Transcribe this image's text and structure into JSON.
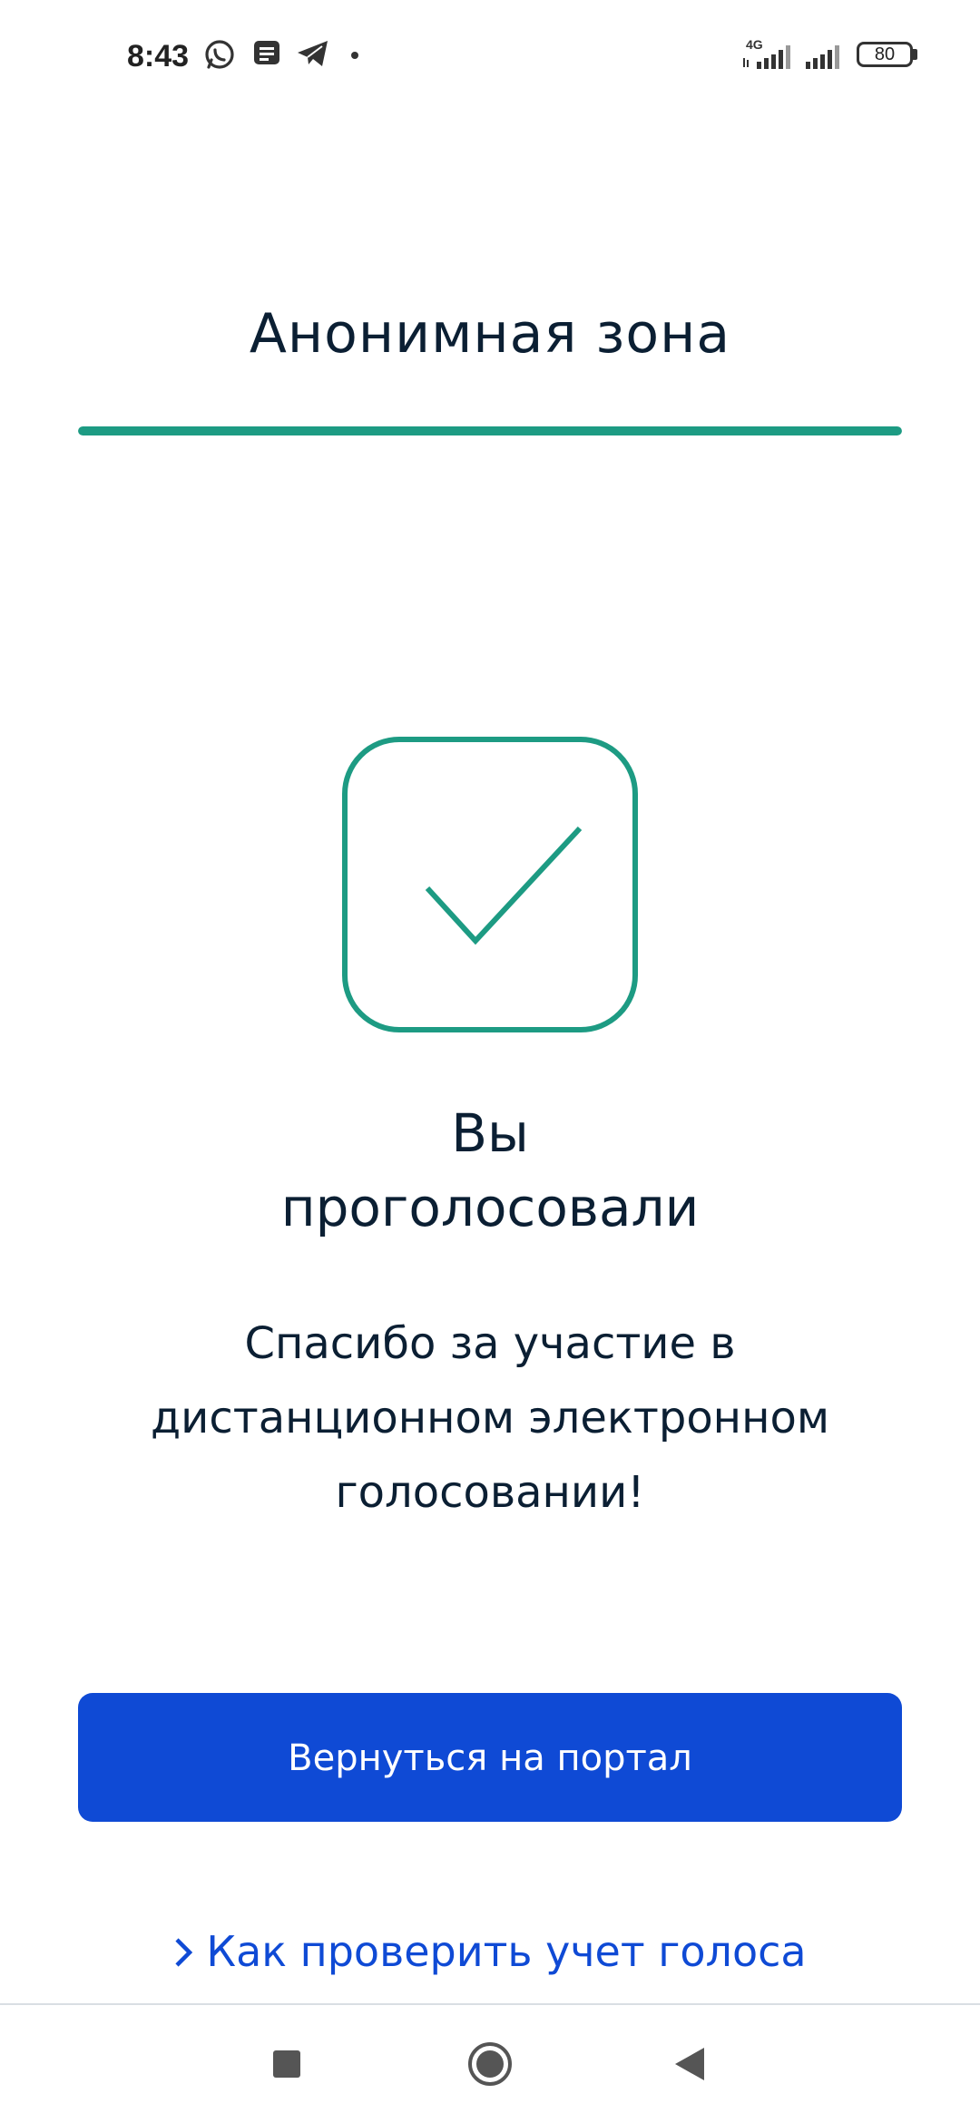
{
  "status_bar": {
    "time": "8:43",
    "notification_icons": [
      "whatsapp-icon",
      "message-icon",
      "telegram-icon",
      "dot-icon"
    ],
    "network_label": "4G",
    "battery_level": "80"
  },
  "header": {
    "title": "Анонимная зона",
    "progress_fraction": 1.0,
    "accent_color": "#1d9b83"
  },
  "result": {
    "icon": "checkmark-icon",
    "title_lines": [
      "Вы",
      "проголосовали"
    ],
    "message_lines": [
      "Спасибо за участие в",
      "дистанционном электронном",
      "голосовании!"
    ]
  },
  "actions": {
    "primary_button_label": "Вернуться на портал",
    "primary_color": "#0f4ad5",
    "help_link_label": "Как проверить учет голоса"
  },
  "nav_bar": {
    "buttons": [
      "recents-square-icon",
      "home-circle-icon",
      "back-triangle-icon"
    ]
  }
}
